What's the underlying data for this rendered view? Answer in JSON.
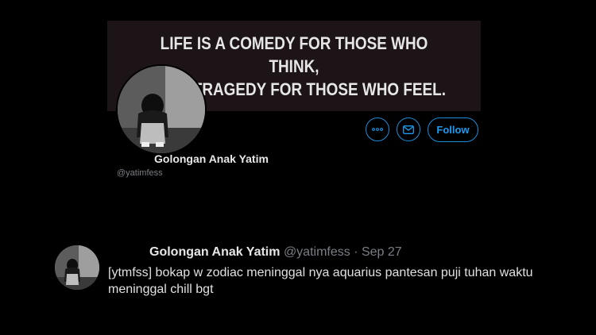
{
  "banner": {
    "line1": "LIFE IS A COMEDY FOR THOSE WHO THINK,",
    "line2": "AND A TRAGEDY FOR THOSE WHO FEEL."
  },
  "profile": {
    "name": "Golongan Anak Yatim",
    "handle": "@yatimfess"
  },
  "actions": {
    "more_icon": "more-dots-icon",
    "message_icon": "envelope-icon",
    "follow_label": "Follow"
  },
  "tweet": {
    "name": "Golongan Anak Yatim",
    "handle": "@yatimfess",
    "separator": "·",
    "date": "Sep 27",
    "text": "[ytmfss] bokap w zodiac meninggal nya aquarius pantesan puji tuhan waktu meninggal chill bgt"
  },
  "colors": {
    "background": "#000000",
    "accent": "#1d9bf0",
    "secondary_text": "#7a7f85"
  }
}
